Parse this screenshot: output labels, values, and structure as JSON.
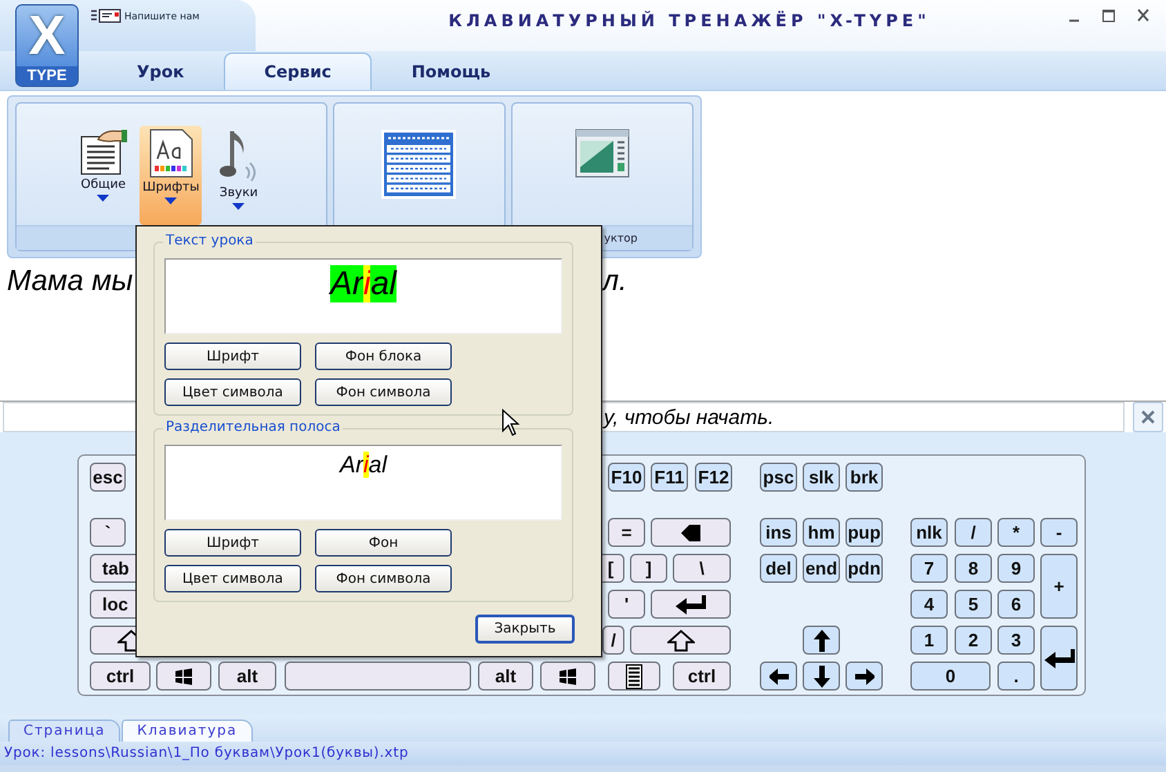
{
  "window": {
    "title": "КЛАВИАТУРНЫЙ ТРЕНАЖЁР \"X-TYPE\"",
    "logo": {
      "top": "X",
      "bottom": "TYPE"
    },
    "quick_action": "Напишите нам"
  },
  "tabs": [
    {
      "label": "Урок",
      "selected": false
    },
    {
      "label": "Сервис",
      "selected": true
    },
    {
      "label": "Помощь",
      "selected": false
    }
  ],
  "ribbon": {
    "groups": [
      {
        "items": [
          {
            "kind": "document",
            "label": "Общие",
            "selected": false
          },
          {
            "kind": "fonts",
            "label": "Шрифты",
            "selected": true
          },
          {
            "kind": "sound",
            "label": "Звуки",
            "selected": false
          }
        ]
      },
      {
        "items": [
          {
            "kind": "table"
          }
        ]
      },
      {
        "items": [
          {
            "kind": "window"
          }
        ],
        "label": "уктор"
      }
    ]
  },
  "lesson_text": [
    "Мама мы",
    "л."
  ],
  "prompt": "у, чтобы начать.",
  "keyboard": {
    "keys": [
      {
        "label": "esc",
        "color": "#ebe8f3"
      },
      {
        "label": "F10",
        "color": "#cfe4fb"
      },
      {
        "label": "F11",
        "color": "#cfe4fb"
      },
      {
        "label": "F12",
        "color": "#cfe4fb"
      },
      {
        "label": "psc",
        "color": "#cfe4fb"
      },
      {
        "label": "slk",
        "color": "#cfe4fb"
      },
      {
        "label": "brk",
        "color": "#cfe4fb"
      },
      {
        "label": "`",
        "color": "#ebe8f3"
      },
      {
        "label": "=",
        "color": "#ebe8f3"
      },
      {
        "kind": "backspace",
        "color": "#ebe8f3"
      },
      {
        "label": "ins",
        "color": "#cfe4fb"
      },
      {
        "label": "hm",
        "color": "#cfe4fb"
      },
      {
        "label": "pup",
        "color": "#cfe4fb"
      },
      {
        "label": "nlk",
        "color": "#cfe4fb"
      },
      {
        "label": "/",
        "color": "#cfe4fb"
      },
      {
        "label": "*",
        "color": "#cfe4fb"
      },
      {
        "label": "-",
        "color": "#cfe4fb"
      },
      {
        "label": "tab",
        "color": "#ebe8f3"
      },
      {
        "label": "[",
        "color": "#ebe8f3"
      },
      {
        "label": "]",
        "color": "#ebe8f3"
      },
      {
        "label": "\\",
        "color": "#ebe8f3"
      },
      {
        "label": "del",
        "color": "#cfe4fb"
      },
      {
        "label": "end",
        "color": "#cfe4fb"
      },
      {
        "label": "pdn",
        "color": "#cfe4fb"
      },
      {
        "label": "7",
        "color": "#cfe4fb"
      },
      {
        "label": "8",
        "color": "#cfe4fb"
      },
      {
        "label": "9",
        "color": "#cfe4fb"
      },
      {
        "label": "+",
        "color": "#cfe4fb"
      },
      {
        "label": "loc",
        "color": "#ebe8f3"
      },
      {
        "label": "'",
        "color": "#ebe8f3"
      },
      {
        "kind": "enter",
        "color": "#ebe8f3"
      },
      {
        "label": "4",
        "color": "#cfe4fb"
      },
      {
        "label": "5",
        "color": "#cfe4fb"
      },
      {
        "label": "6",
        "color": "#cfe4fb"
      },
      {
        "kind": "shift",
        "color": "#ebe8f3"
      },
      {
        "label": "/",
        "color": "#ebe8f3"
      },
      {
        "kind": "shift",
        "color": "#ebe8f3"
      },
      {
        "kind": "up",
        "color": "#cfe4fb"
      },
      {
        "label": "1",
        "color": "#cfe4fb"
      },
      {
        "label": "2",
        "color": "#cfe4fb"
      },
      {
        "label": "3",
        "color": "#cfe4fb"
      },
      {
        "kind": "enter",
        "color": "#cfe4fb"
      },
      {
        "label": "ctrl",
        "color": "#ebe8f3"
      },
      {
        "kind": "win",
        "color": "#ebe8f3"
      },
      {
        "label": "alt",
        "color": "#ebe8f3"
      },
      {
        "kind": "space",
        "color": "#ebe8f3"
      },
      {
        "label": "alt",
        "color": "#ebe8f3"
      },
      {
        "kind": "win",
        "color": "#ebe8f3"
      },
      {
        "kind": "menu",
        "color": "#ebe8f3"
      },
      {
        "label": "ctrl",
        "color": "#ebe8f3"
      },
      {
        "kind": "left",
        "color": "#cfe4fb"
      },
      {
        "kind": "down",
        "color": "#cfe4fb"
      },
      {
        "kind": "right",
        "color": "#cfe4fb"
      },
      {
        "label": "0",
        "color": "#cfe4fb"
      },
      {
        "label": ".",
        "color": "#cfe4fb"
      }
    ]
  },
  "bottom_tabs": [
    {
      "label": "Страница",
      "selected": false
    },
    {
      "label": "Клавиатура",
      "selected": true
    }
  ],
  "status_bar": "Урок: lessons\\Russian\\1_По буквам\\Урок1(буквы).xtp",
  "dialog": {
    "groups": [
      {
        "title": "Текст урока",
        "preview": {
          "kind": "block",
          "segments": [
            {
              "text": "Ar",
              "kind": "normal"
            },
            {
              "text": "i",
              "kind": "current"
            },
            {
              "text": "al",
              "kind": "normal"
            }
          ]
        },
        "buttons": [
          "Шрифт",
          "Фон блока",
          "Цвет символа",
          "Фон символа"
        ]
      },
      {
        "title": "Разделительная полоса",
        "preview": {
          "kind": "strip",
          "segments": [
            {
              "text": "Ar",
              "kind": "normal"
            },
            {
              "text": "i",
              "kind": "current"
            },
            {
              "text": "al",
              "kind": "normal"
            }
          ]
        },
        "buttons": [
          "Шрифт",
          "Фон",
          "Цвет символа",
          "Фон символа"
        ]
      }
    ],
    "close_button": "Закрыть"
  }
}
